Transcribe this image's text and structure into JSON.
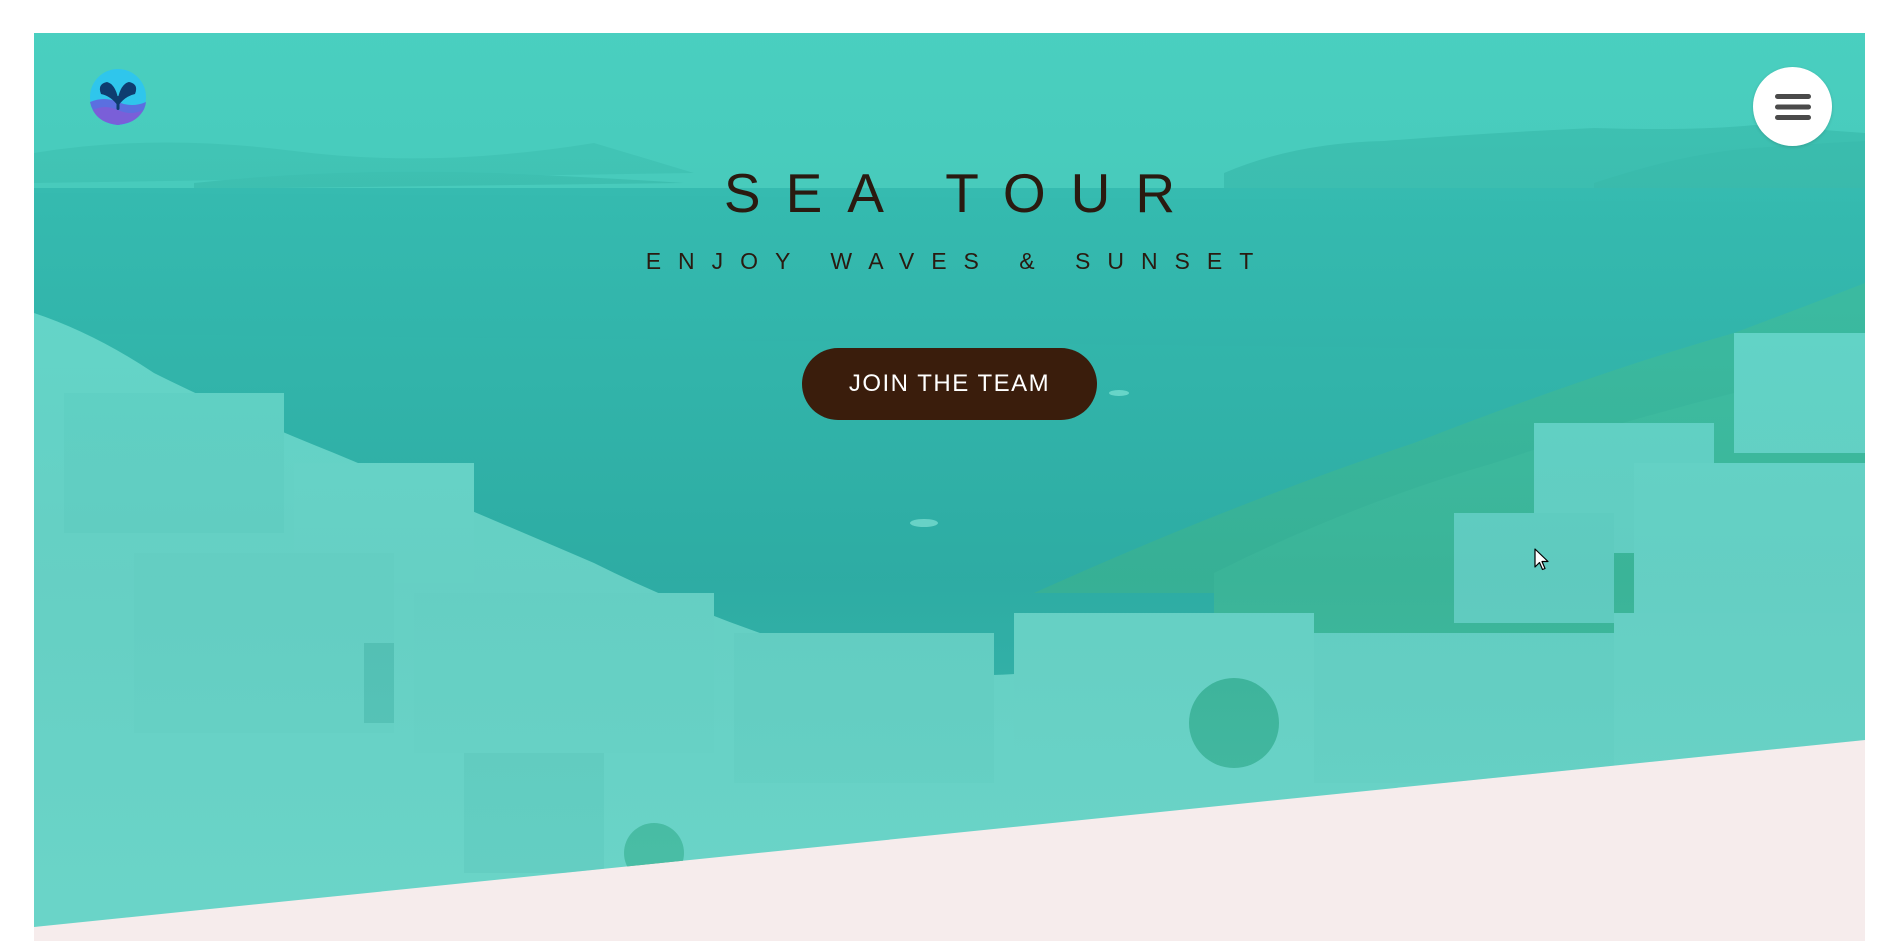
{
  "hero": {
    "title": "SEA TOUR",
    "subtitle": "ENJOY WAVES & SUNSET",
    "cta_label": "JOIN THE TEAM"
  },
  "header": {
    "logo_icon": "leaf-drop-logo-icon",
    "menu_icon": "hamburger-menu-icon"
  },
  "colors": {
    "overlay": "#40d6c4",
    "title_text": "#2a1a10",
    "cta_background": "#3a1d0c",
    "cta_text": "#ffffff",
    "section_background": "#f6ecec"
  }
}
